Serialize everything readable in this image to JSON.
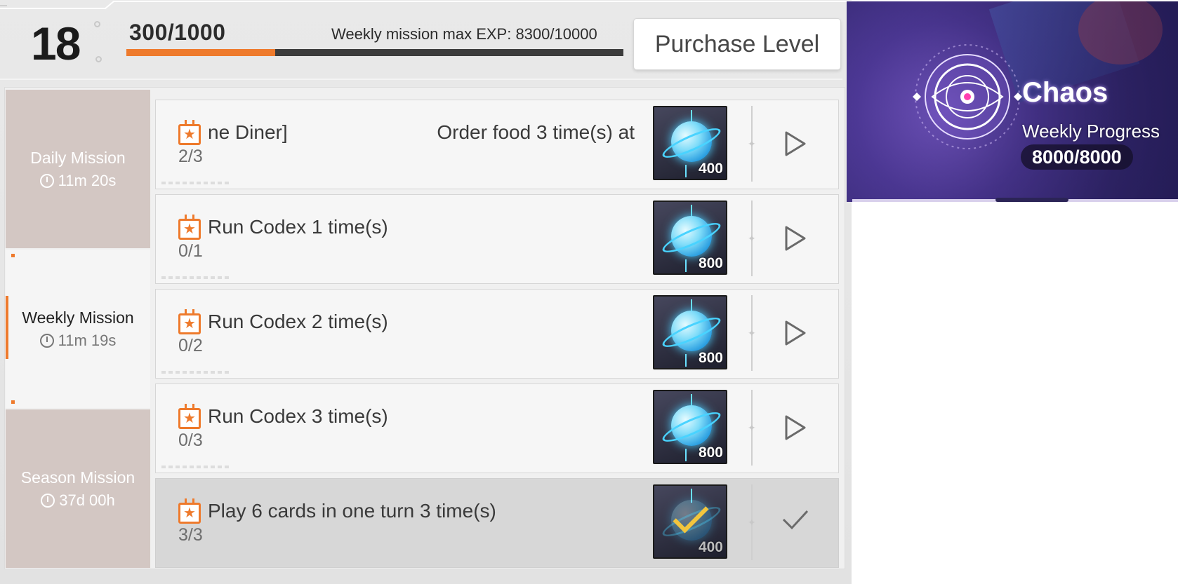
{
  "header": {
    "level": "18",
    "exp_text": "300/1000",
    "exp_fraction": 0.3,
    "weekly_max_text": "Weekly mission max EXP: 8300/10000",
    "purchase_label": "Purchase Level",
    "accent_color": "#ee7a2c"
  },
  "tabs": [
    {
      "label": "Daily Mission",
      "timer": "11m 20s",
      "active": false
    },
    {
      "label": "Weekly Mission",
      "timer": "11m 19s",
      "active": true
    },
    {
      "label": "Season Mission",
      "timer": "37d 00h",
      "active": false
    }
  ],
  "missions": [
    {
      "title": "ne Diner]",
      "title_right": "Order food 3 time(s) at",
      "progress": "2/3",
      "reward": "400",
      "status": "go",
      "icon": "calendar-star-icon"
    },
    {
      "title": "Run Codex 1 time(s)",
      "title_right": "",
      "progress": "0/1",
      "reward": "800",
      "status": "go",
      "icon": "calendar-star-icon"
    },
    {
      "title": "Run Codex 2 time(s)",
      "title_right": "",
      "progress": "0/2",
      "reward": "800",
      "status": "go",
      "icon": "calendar-star-icon"
    },
    {
      "title": "Run Codex 3 time(s)",
      "title_right": "",
      "progress": "0/3",
      "reward": "800",
      "status": "go",
      "icon": "calendar-star-icon"
    },
    {
      "title": "Play 6 cards in one turn 3 time(s)",
      "title_right": "",
      "progress": "3/3",
      "reward": "400",
      "status": "done",
      "icon": "calendar-star-icon"
    }
  ],
  "chaos": {
    "title": "Chaos",
    "subtitle": "Weekly Progress",
    "value": "8000/8000"
  }
}
